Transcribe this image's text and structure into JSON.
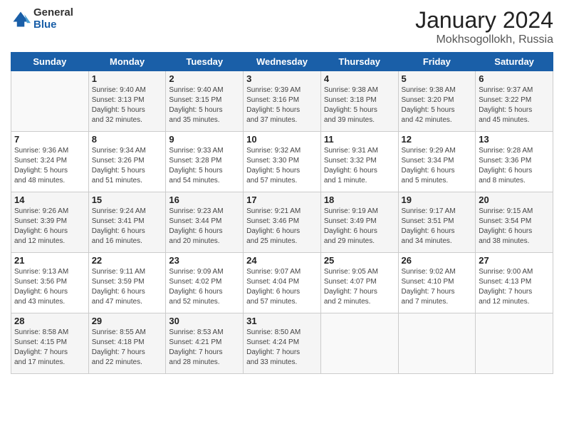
{
  "header": {
    "logo_general": "General",
    "logo_blue": "Blue",
    "month_title": "January 2024",
    "location": "Mokhsogollokh, Russia"
  },
  "days_of_week": [
    "Sunday",
    "Monday",
    "Tuesday",
    "Wednesday",
    "Thursday",
    "Friday",
    "Saturday"
  ],
  "weeks": [
    [
      {
        "day": "",
        "info": ""
      },
      {
        "day": "1",
        "info": "Sunrise: 9:40 AM\nSunset: 3:13 PM\nDaylight: 5 hours\nand 32 minutes."
      },
      {
        "day": "2",
        "info": "Sunrise: 9:40 AM\nSunset: 3:15 PM\nDaylight: 5 hours\nand 35 minutes."
      },
      {
        "day": "3",
        "info": "Sunrise: 9:39 AM\nSunset: 3:16 PM\nDaylight: 5 hours\nand 37 minutes."
      },
      {
        "day": "4",
        "info": "Sunrise: 9:38 AM\nSunset: 3:18 PM\nDaylight: 5 hours\nand 39 minutes."
      },
      {
        "day": "5",
        "info": "Sunrise: 9:38 AM\nSunset: 3:20 PM\nDaylight: 5 hours\nand 42 minutes."
      },
      {
        "day": "6",
        "info": "Sunrise: 9:37 AM\nSunset: 3:22 PM\nDaylight: 5 hours\nand 45 minutes."
      }
    ],
    [
      {
        "day": "7",
        "info": "Sunrise: 9:36 AM\nSunset: 3:24 PM\nDaylight: 5 hours\nand 48 minutes."
      },
      {
        "day": "8",
        "info": "Sunrise: 9:34 AM\nSunset: 3:26 PM\nDaylight: 5 hours\nand 51 minutes."
      },
      {
        "day": "9",
        "info": "Sunrise: 9:33 AM\nSunset: 3:28 PM\nDaylight: 5 hours\nand 54 minutes."
      },
      {
        "day": "10",
        "info": "Sunrise: 9:32 AM\nSunset: 3:30 PM\nDaylight: 5 hours\nand 57 minutes."
      },
      {
        "day": "11",
        "info": "Sunrise: 9:31 AM\nSunset: 3:32 PM\nDaylight: 6 hours\nand 1 minute."
      },
      {
        "day": "12",
        "info": "Sunrise: 9:29 AM\nSunset: 3:34 PM\nDaylight: 6 hours\nand 5 minutes."
      },
      {
        "day": "13",
        "info": "Sunrise: 9:28 AM\nSunset: 3:36 PM\nDaylight: 6 hours\nand 8 minutes."
      }
    ],
    [
      {
        "day": "14",
        "info": "Sunrise: 9:26 AM\nSunset: 3:39 PM\nDaylight: 6 hours\nand 12 minutes."
      },
      {
        "day": "15",
        "info": "Sunrise: 9:24 AM\nSunset: 3:41 PM\nDaylight: 6 hours\nand 16 minutes."
      },
      {
        "day": "16",
        "info": "Sunrise: 9:23 AM\nSunset: 3:44 PM\nDaylight: 6 hours\nand 20 minutes."
      },
      {
        "day": "17",
        "info": "Sunrise: 9:21 AM\nSunset: 3:46 PM\nDaylight: 6 hours\nand 25 minutes."
      },
      {
        "day": "18",
        "info": "Sunrise: 9:19 AM\nSunset: 3:49 PM\nDaylight: 6 hours\nand 29 minutes."
      },
      {
        "day": "19",
        "info": "Sunrise: 9:17 AM\nSunset: 3:51 PM\nDaylight: 6 hours\nand 34 minutes."
      },
      {
        "day": "20",
        "info": "Sunrise: 9:15 AM\nSunset: 3:54 PM\nDaylight: 6 hours\nand 38 minutes."
      }
    ],
    [
      {
        "day": "21",
        "info": "Sunrise: 9:13 AM\nSunset: 3:56 PM\nDaylight: 6 hours\nand 43 minutes."
      },
      {
        "day": "22",
        "info": "Sunrise: 9:11 AM\nSunset: 3:59 PM\nDaylight: 6 hours\nand 47 minutes."
      },
      {
        "day": "23",
        "info": "Sunrise: 9:09 AM\nSunset: 4:02 PM\nDaylight: 6 hours\nand 52 minutes."
      },
      {
        "day": "24",
        "info": "Sunrise: 9:07 AM\nSunset: 4:04 PM\nDaylight: 6 hours\nand 57 minutes."
      },
      {
        "day": "25",
        "info": "Sunrise: 9:05 AM\nSunset: 4:07 PM\nDaylight: 7 hours\nand 2 minutes."
      },
      {
        "day": "26",
        "info": "Sunrise: 9:02 AM\nSunset: 4:10 PM\nDaylight: 7 hours\nand 7 minutes."
      },
      {
        "day": "27",
        "info": "Sunrise: 9:00 AM\nSunset: 4:13 PM\nDaylight: 7 hours\nand 12 minutes."
      }
    ],
    [
      {
        "day": "28",
        "info": "Sunrise: 8:58 AM\nSunset: 4:15 PM\nDaylight: 7 hours\nand 17 minutes."
      },
      {
        "day": "29",
        "info": "Sunrise: 8:55 AM\nSunset: 4:18 PM\nDaylight: 7 hours\nand 22 minutes."
      },
      {
        "day": "30",
        "info": "Sunrise: 8:53 AM\nSunset: 4:21 PM\nDaylight: 7 hours\nand 28 minutes."
      },
      {
        "day": "31",
        "info": "Sunrise: 8:50 AM\nSunset: 4:24 PM\nDaylight: 7 hours\nand 33 minutes."
      },
      {
        "day": "",
        "info": ""
      },
      {
        "day": "",
        "info": ""
      },
      {
        "day": "",
        "info": ""
      }
    ]
  ]
}
